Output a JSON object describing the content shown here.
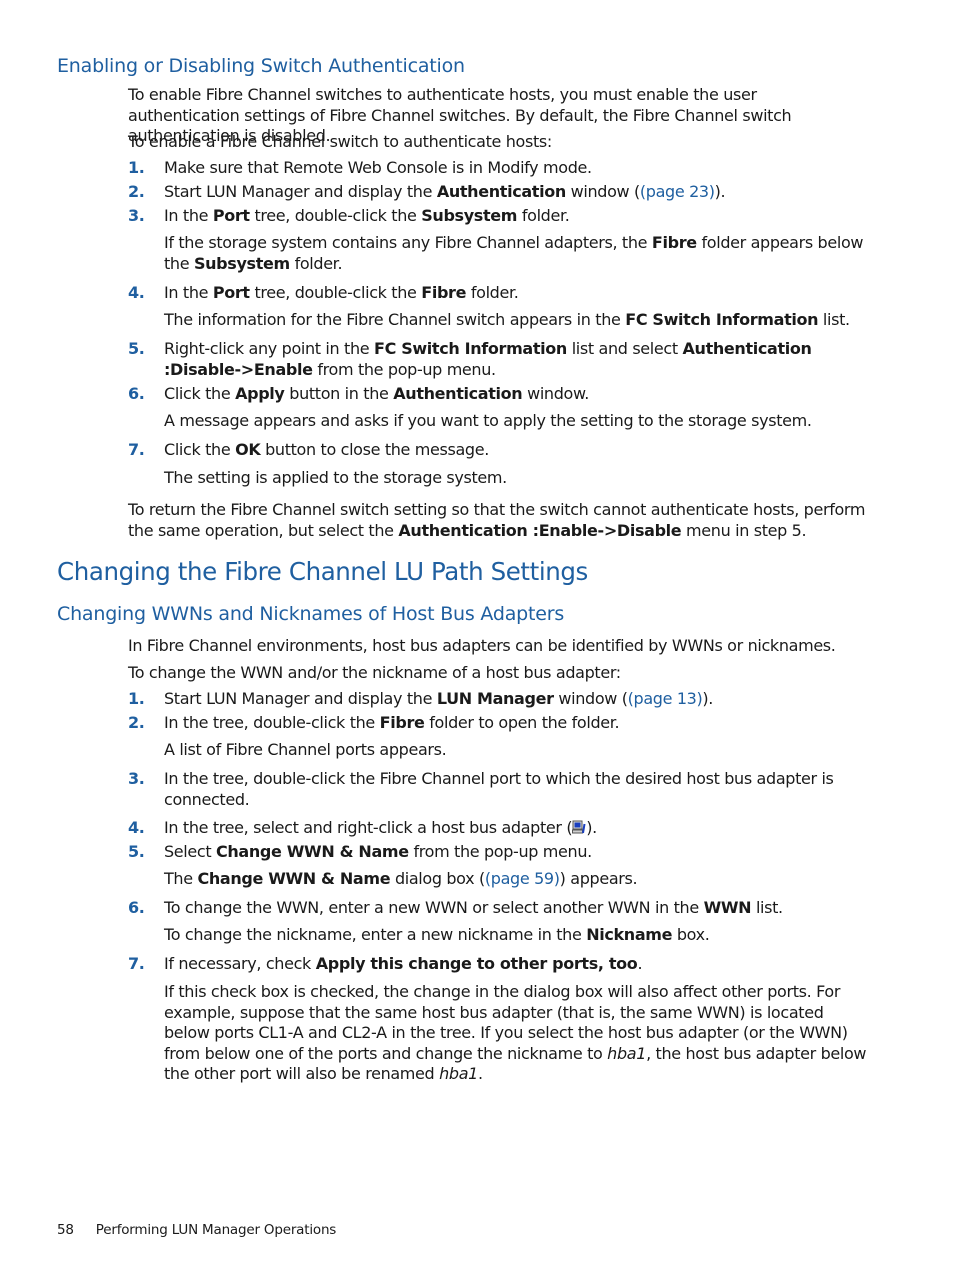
{
  "section1": {
    "title": "Enabling or Disabling Switch Authentication",
    "intro1": "To enable Fibre Channel switches to authenticate hosts, you must enable the user authentication settings of Fibre Channel switches. By default, the Fibre Channel switch authentication is disabled.",
    "intro2": "To enable a Fibre Channel switch to authenticate hosts:",
    "steps": [
      {
        "num": "1.",
        "text": "Make sure that Remote Web Console is in Modify mode."
      },
      {
        "num": "2.",
        "pre": "Start LUN Manager and display the ",
        "bold": "Authentication",
        "mid": " window (",
        "link": "(page 23)",
        "post": ")."
      },
      {
        "num": "3.",
        "pre": "In the ",
        "bold1": "Port",
        "mid": " tree, double-click the ",
        "bold2": "Subsystem",
        "post": " folder.",
        "note": {
          "pre": "If the storage system contains any Fibre Channel adapters, the ",
          "bold1": "Fibre",
          "mid": " folder appears below the ",
          "bold2": "Subsystem",
          "post": " folder."
        }
      },
      {
        "num": "4.",
        "pre": "In the ",
        "bold1": "Port",
        "mid": " tree, double-click the ",
        "bold2": "Fibre",
        "post": " folder.",
        "note": {
          "pre": "The information for the Fibre Channel switch appears in the ",
          "bold": "FC Switch Information",
          "post": " list."
        }
      },
      {
        "num": "5.",
        "pre": "Right-click any point in the ",
        "bold1": "FC Switch Information",
        "mid": " list and select ",
        "bold2": "Authentication :Disable->Enable",
        "post": " from the pop-up menu."
      },
      {
        "num": "6.",
        "pre": "Click the ",
        "bold1": "Apply",
        "mid": " button in the ",
        "bold2": "Authentication",
        "post": " window.",
        "note": "A message appears and asks if you want to apply the setting to the storage system."
      },
      {
        "num": "7.",
        "pre": "Click the ",
        "bold": "OK",
        "post": " button to close the message.",
        "note": "The setting is applied to the storage system."
      }
    ],
    "outro": {
      "pre": "To return the Fibre Channel switch setting so that the switch cannot authenticate hosts, perform the same operation, but select the ",
      "bold": "Authentication :Enable->Disable",
      "post": " menu in step 5."
    }
  },
  "section2": {
    "title": "Changing the Fibre Channel LU Path Settings",
    "subtitle": "Changing WWNs and Nicknames of Host Bus Adapters",
    "intro1": "In Fibre Channel environments, host bus adapters can be identified by WWNs or nicknames.",
    "intro2": "To change the WWN and/or the nickname of a host bus adapter:",
    "steps": [
      {
        "num": "1.",
        "pre": "Start LUN Manager and display the ",
        "bold": "LUN Manager",
        "mid": " window (",
        "link": "(page 13)",
        "post": ")."
      },
      {
        "num": "2.",
        "pre": "In the tree, double-click the ",
        "bold": "Fibre",
        "post": " folder to open the folder.",
        "note": "A list of Fibre Channel ports appears."
      },
      {
        "num": "3.",
        "text": "In the tree, double-click the Fibre Channel port to which the desired host bus adapter is connected."
      },
      {
        "num": "4.",
        "pre": "In the tree, select and right-click a host bus adapter (",
        "icon": "host-bus-adapter-icon",
        "post": ")."
      },
      {
        "num": "5.",
        "pre": "Select ",
        "bold": "Change WWN & Name",
        "post": " from the pop-up menu.",
        "note": {
          "pre": "The ",
          "bold": "Change WWN & Name",
          "mid": " dialog box (",
          "link": "(page 59)",
          "post": ") appears."
        }
      },
      {
        "num": "6.",
        "pre": "To change the WWN, enter a new WWN or select another WWN in the ",
        "bold": "WWN",
        "post": " list.",
        "note": {
          "pre": "To change the nickname, enter a new nickname in the ",
          "bold": "Nickname",
          "post": " box."
        }
      },
      {
        "num": "7.",
        "pre": "If necessary, check ",
        "bold": "Apply this change to other ports, too",
        "post": ".",
        "note": {
          "pre": "If this check box is checked, the change in the dialog box will also affect other ports. For example, suppose that the same host bus adapter (that is, the same WWN) is located below ports CL1-A and CL2-A in the tree. If you select the host bus adapter (or the WWN) from below one of the ports and change the nickname to ",
          "italic1": "hba1",
          "mid": ", the host bus adapter below the other port will also be renamed ",
          "italic2": "hba1",
          "post": "."
        }
      }
    ]
  },
  "footer": {
    "page_number": "58",
    "chapter": "Performing LUN Manager Operations"
  },
  "colors": {
    "heading": "#1f5fa0",
    "text": "#1a1a1a"
  }
}
